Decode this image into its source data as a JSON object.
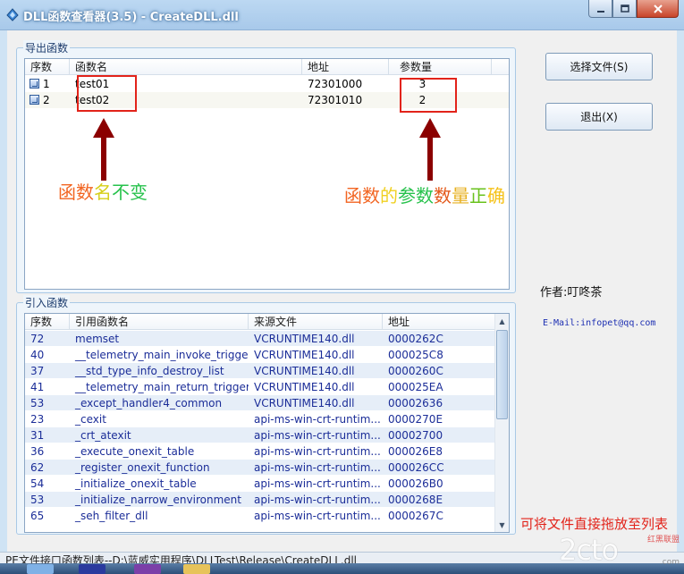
{
  "window": {
    "title": "DLL函数查看器(3.5) - CreateDLL.dll",
    "controls": {
      "minimize": "─",
      "maximize": "□",
      "close": "✕"
    }
  },
  "export_group": {
    "title": "导出函数",
    "columns": [
      "序数",
      "函数名",
      "地址",
      "参数量"
    ],
    "rows": [
      {
        "ordinal": "1",
        "name": "test01",
        "address": "72301000",
        "params": "3"
      },
      {
        "ordinal": "2",
        "name": "test02",
        "address": "72301010",
        "params": "2"
      }
    ]
  },
  "annotations": {
    "left_parts": [
      {
        "text": "函数",
        "color": "#f26522"
      },
      {
        "text": "名",
        "color": "#d6cf1a"
      },
      {
        "text": "不变",
        "color": "#27c24c"
      }
    ],
    "right_parts": [
      {
        "text": "函数",
        "color": "#f26522"
      },
      {
        "text": "的",
        "color": "#f0d020"
      },
      {
        "text": "参数",
        "color": "#27c24c"
      },
      {
        "text": "数",
        "color": "#e45a1c"
      },
      {
        "text": "量",
        "color": "#e7b020"
      },
      {
        "text": "正",
        "color": "#69c21d"
      },
      {
        "text": "确",
        "color": "#f5c21a"
      }
    ],
    "accent_red": "#e2231a",
    "arrow_color": "#8b0000"
  },
  "import_group": {
    "title": "引入函数",
    "columns": [
      "序数",
      "引用函数名",
      "来源文件",
      "地址"
    ],
    "rows": [
      {
        "ordinal": "72",
        "name": "memset",
        "source": "VCRUNTIME140.dll",
        "address": "0000262C"
      },
      {
        "ordinal": "40",
        "name": "__telemetry_main_invoke_trigger",
        "source": "VCRUNTIME140.dll",
        "address": "000025C8"
      },
      {
        "ordinal": "37",
        "name": "__std_type_info_destroy_list",
        "source": "VCRUNTIME140.dll",
        "address": "0000260C"
      },
      {
        "ordinal": "41",
        "name": "__telemetry_main_return_trigger",
        "source": "VCRUNTIME140.dll",
        "address": "000025EA"
      },
      {
        "ordinal": "53",
        "name": "_except_handler4_common",
        "source": "VCRUNTIME140.dll",
        "address": "00002636"
      },
      {
        "ordinal": "23",
        "name": "_cexit",
        "source": "api-ms-win-crt-runtim...",
        "address": "0000270E"
      },
      {
        "ordinal": "31",
        "name": "_crt_atexit",
        "source": "api-ms-win-crt-runtim...",
        "address": "00002700"
      },
      {
        "ordinal": "36",
        "name": "_execute_onexit_table",
        "source": "api-ms-win-crt-runtim...",
        "address": "000026E8"
      },
      {
        "ordinal": "62",
        "name": "_register_onexit_function",
        "source": "api-ms-win-crt-runtim...",
        "address": "000026CC"
      },
      {
        "ordinal": "54",
        "name": "_initialize_onexit_table",
        "source": "api-ms-win-crt-runtim...",
        "address": "000026B0"
      },
      {
        "ordinal": "53",
        "name": "_initialize_narrow_environment",
        "source": "api-ms-win-crt-runtim...",
        "address": "0000268E"
      },
      {
        "ordinal": "65",
        "name": "_seh_filter_dll",
        "source": "api-ms-win-crt-runtim...",
        "address": "0000267C"
      }
    ]
  },
  "buttons": {
    "select_file": "选择文件(S)",
    "exit": "退出(X)"
  },
  "author": "作者:叮咚茶",
  "email": "E-Mail:infopet@qq.com",
  "drop_hint": "可将文件直接拖放至列表",
  "status": "PE文件接口函数列表--D:\\蓝威实用程序\\DLLTest\\Release\\CreateDLL.dll",
  "watermark": {
    "main": "2cto",
    "top_small": "红黑联盟",
    "url": ".com"
  }
}
